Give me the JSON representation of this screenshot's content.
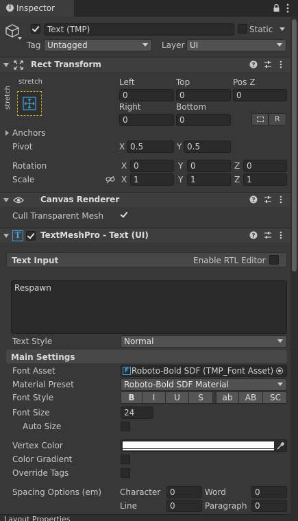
{
  "tab": {
    "title": "Inspector",
    "lock_icon": "lock-icon",
    "menu_icon": "kebab-menu-icon"
  },
  "object": {
    "name": "Text (TMP)",
    "static_label": "Static",
    "tag_label": "Tag",
    "tag_value": "Untagged",
    "layer_label": "Layer",
    "layer_value": "UI"
  },
  "rect_transform": {
    "title": "Rect Transform",
    "anchor_top": "stretch",
    "anchor_left": "stretch",
    "left_label": "Left",
    "top_label": "Top",
    "posz_label": "Pos Z",
    "left": "0",
    "top": "0",
    "posz": "0",
    "right_label": "Right",
    "bottom_label": "Bottom",
    "right": "0",
    "bottom": "0",
    "r_button": "R",
    "anchors_label": "Anchors",
    "pivot_label": "Pivot",
    "pivot_x": "0.5",
    "pivot_y": "0.5",
    "x_label": "X",
    "y_label": "Y",
    "z_label": "Z",
    "rotation_label": "Rotation",
    "rot_x": "0",
    "rot_y": "0",
    "rot_z": "0",
    "scale_label": "Scale",
    "scale_x": "1",
    "scale_y": "1",
    "scale_z": "1"
  },
  "canvas_renderer": {
    "title": "Canvas Renderer",
    "cull_label": "Cull Transparent Mesh"
  },
  "tmp": {
    "title": "TextMeshPro - Text (UI)",
    "text_input_label": "Text Input",
    "rtl_label": "Enable RTL Editor",
    "text_value": "Respawn",
    "text_style_label": "Text Style",
    "text_style_value": "Normal",
    "main_settings_label": "Main Settings",
    "font_asset_label": "Font Asset",
    "font_asset_value": "Roboto-Bold SDF (TMP_Font Asset)",
    "material_preset_label": "Material Preset",
    "material_preset_value": "Roboto-Bold SDF Material",
    "font_style_label": "Font Style",
    "font_style_buttons": [
      "B",
      "I",
      "U",
      "S",
      "ab",
      "AB",
      "SC"
    ],
    "font_size_label": "Font Size",
    "font_size_value": "24",
    "auto_size_label": "Auto Size",
    "vertex_color_label": "Vertex Color",
    "vertex_color": "#ffffff",
    "color_gradient_label": "Color Gradient",
    "override_tags_label": "Override Tags",
    "spacing_label": "Spacing Options (em)",
    "character_label": "Character",
    "character_value": "0",
    "word_label": "Word",
    "word_value": "0",
    "line_label": "Line",
    "line_value": "0",
    "paragraph_label": "Paragraph",
    "paragraph_value": "0"
  },
  "layout_properties": {
    "title": "Layout Properties"
  }
}
